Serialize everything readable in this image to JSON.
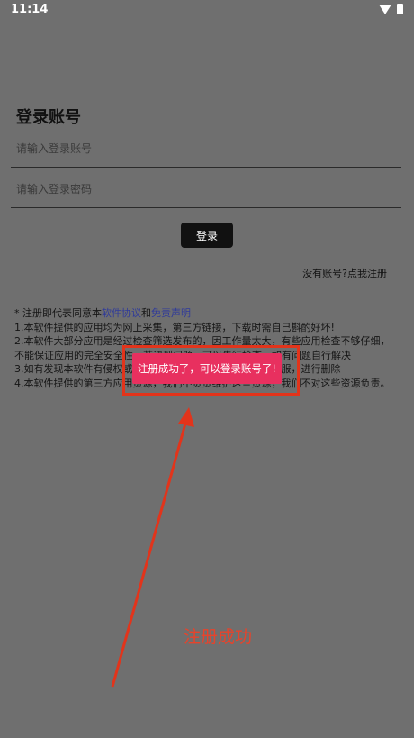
{
  "status_bar": {
    "time": "11:14"
  },
  "login": {
    "title": "登录账号",
    "account_placeholder": "请输入登录账号",
    "password_placeholder": "请输入登录密码",
    "login_button": "登录",
    "register_link": "没有账号?点我注册"
  },
  "notice": {
    "prefix": "* 注册即代表同意本",
    "agreement_link": "软件协议",
    "and": "和",
    "disclaimer_link": "免责声明",
    "items": [
      "1.本软件提供的应用均为网上采集，第三方链接，下载时需自己斟酌好坏!",
      "2.本软件大部分应用是经过检查筛选发布的，因工作量太大，有些应用检查不够仔细，不能保证应用的完全安全性，若遇到问题，可以先行检查，如有问题自行解决",
      "3.如有发现本软件有侵权或者违规内容的应用，请及时联系客服，进行删除",
      "4.本软件提供的第三方应用资源，我们不负责维护这些资源，我们不对这些资源负责。"
    ]
  },
  "toast": {
    "message": "注册成功了，可以登录账号了!"
  },
  "annotation": {
    "label": "注册成功",
    "color": "#e7432b"
  }
}
